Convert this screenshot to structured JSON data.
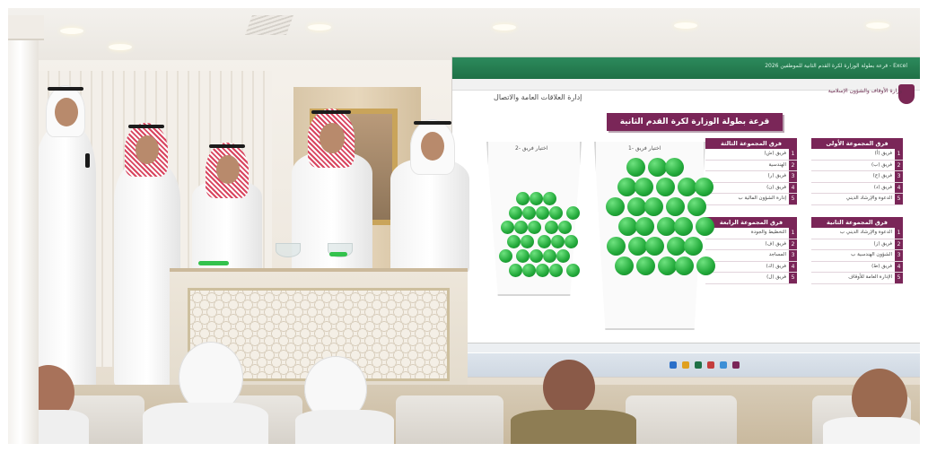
{
  "screen": {
    "app_title": "قرعة بطولة الوزارة لكرة القدم الثانية للموظفين 2026 - Excel",
    "department": "إدارة العلاقات العامة والاتصال",
    "ministry": "وزارة الأوقاف والشؤون الإسلامية",
    "title": "قرعة بطولة الوزارة لكرة القدم الثانية للموظفين 2026",
    "jar_left_label": "2- اختيار فريق",
    "jar_right_label": "1- اختيار فريق",
    "groups": [
      {
        "name": "فرق المجموعة الأولى",
        "teams": [
          "فريق (أ)",
          "فريق (ب)",
          "فريق (ج)",
          "فريق (د)",
          "الدعوة والإرشاد الديني"
        ]
      },
      {
        "name": "فرق المجموعة الثالثة",
        "teams": [
          "فريق (ش)",
          "الهندسية",
          "فريق (ر)",
          "فريق (ن)",
          "إدارة الشؤون المالية ب"
        ]
      },
      {
        "name": "فرق المجموعة الثانية",
        "teams": [
          "الدعوة والإرشاد الديني ب",
          "فريق (ز)",
          "الشؤون الهندسية ب",
          "فريق (ط)",
          "الإدارة العامة للأوقاف"
        ]
      },
      {
        "name": "فرق المجموعة الرابعة",
        "teams": [
          "التخطيط والجودة",
          "فريق (ف)",
          "المساجد",
          "فريق (ك)",
          "فريق (ل)"
        ]
      }
    ]
  },
  "colors": {
    "brand_maroon": "#7a2658",
    "ball_green": "#22a93a",
    "excel_green": "#1f7046"
  }
}
